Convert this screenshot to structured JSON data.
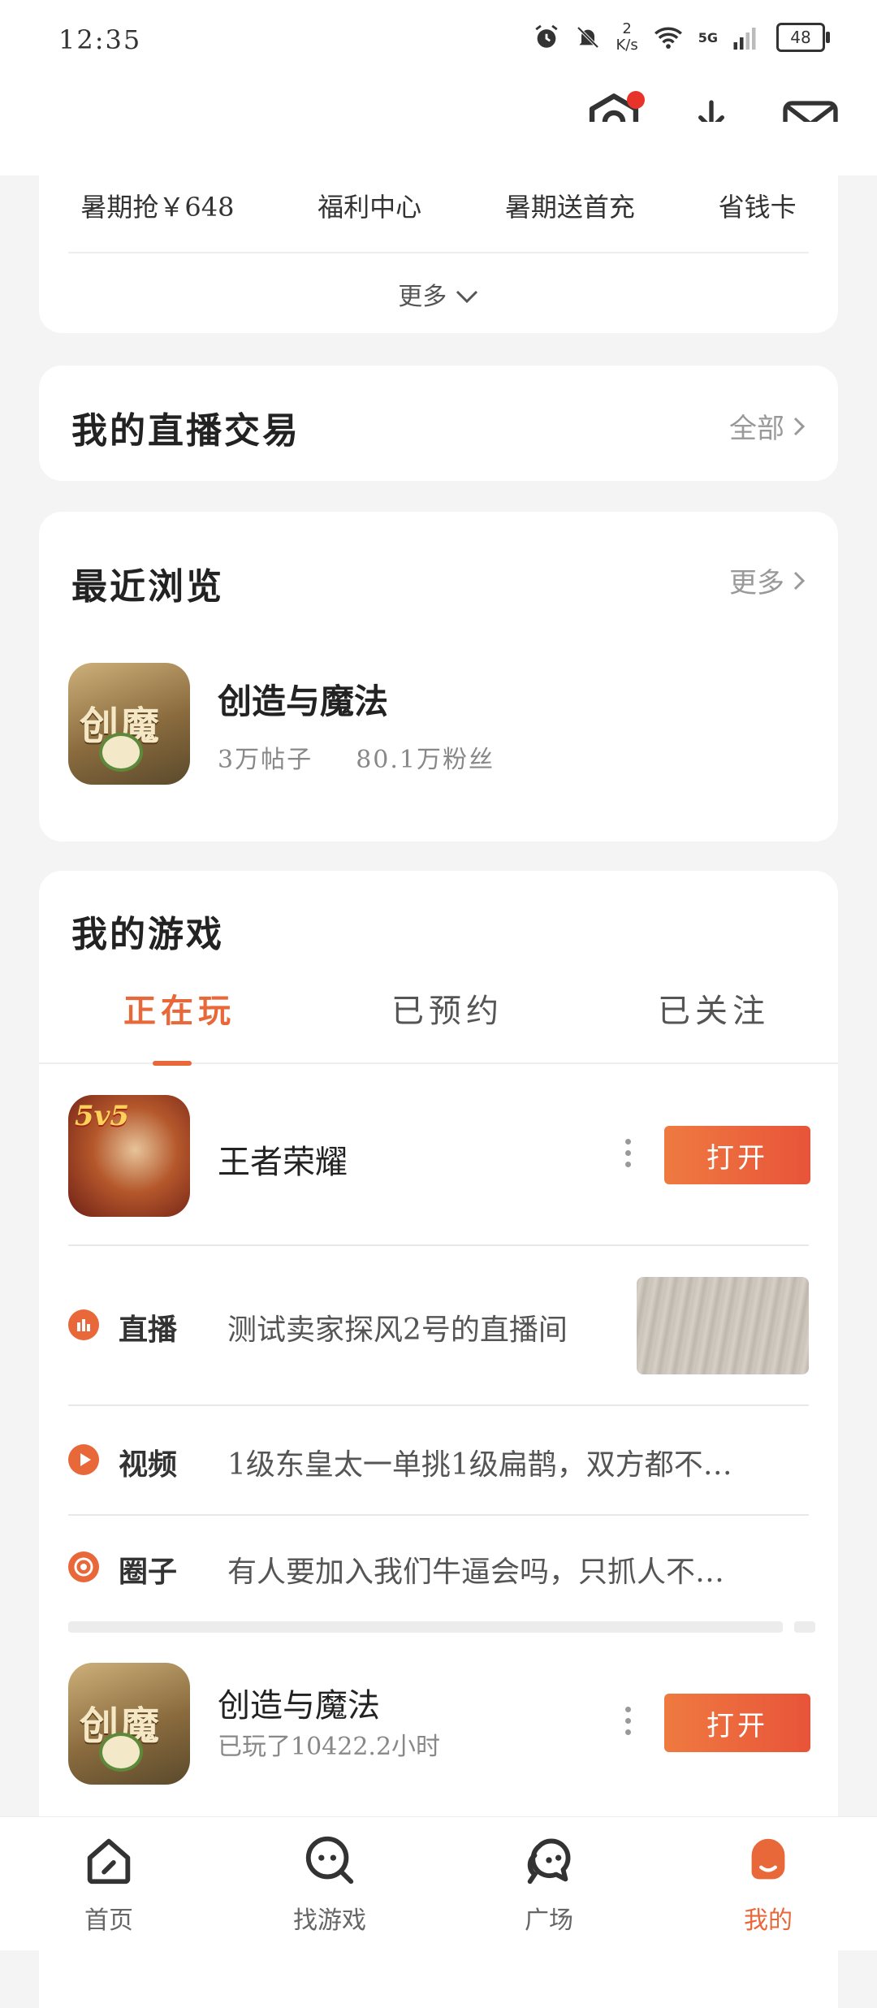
{
  "status_bar": {
    "time": "12:35",
    "net_speed_value": "2",
    "net_speed_unit": "K/s",
    "network": "5G",
    "battery": "48"
  },
  "quick_menu": {
    "items": [
      "暑期抢￥648",
      "福利中心",
      "暑期送首充",
      "省钱卡"
    ],
    "more_label": "更多"
  },
  "live_trade": {
    "title": "我的直播交易",
    "link": "全部"
  },
  "recent": {
    "title": "最近浏览",
    "link": "更多",
    "item": {
      "name": "创造与魔法",
      "posts": "3万帖子",
      "fans": "80.1万粉丝",
      "icon_text": "创魔"
    }
  },
  "my_games": {
    "title": "我的游戏",
    "tabs": [
      "正在玩",
      "已预约",
      "已关注"
    ],
    "games": [
      {
        "name": "王者荣耀",
        "sub": "",
        "button": "打开",
        "icon_text": "5v5"
      },
      {
        "name": "创造与魔法",
        "sub": "已玩了10422.2小时",
        "button": "打开",
        "icon_text": "创魔"
      }
    ],
    "feeds": [
      {
        "type": "直播",
        "text": "测试卖家探风2号的直播间",
        "icon": "live-icon"
      },
      {
        "type": "视频",
        "text": "1级东皇太一单挑1级扁鹊，双方都不…",
        "icon": "video-play-icon"
      },
      {
        "type": "圈子",
        "text": "有人要加入我们牛逼会吗，只抓人不…",
        "icon": "circle-target-icon"
      }
    ]
  },
  "bottom_nav": [
    "首页",
    "找游戏",
    "广场",
    "我的"
  ],
  "colors": {
    "accent": "#e8683a",
    "button": "#e8543a",
    "red_dot": "#e8332a"
  }
}
